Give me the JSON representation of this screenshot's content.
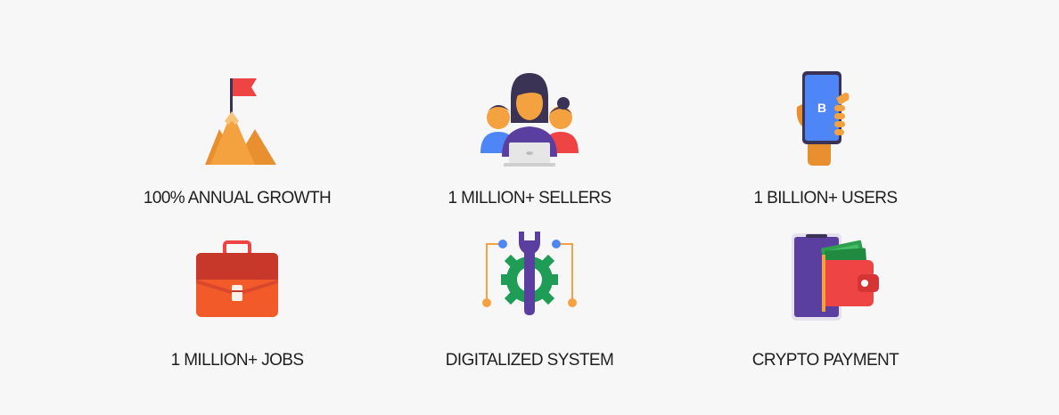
{
  "features": [
    {
      "label": "100% ANNUAL GROWTH",
      "icon": "mountain-flag-icon"
    },
    {
      "label": "1 MILLION+ SELLERS",
      "icon": "sellers-group-icon"
    },
    {
      "label": "1 BILLION+ USERS",
      "icon": "phone-in-hand-icon",
      "phone_letter": "B"
    },
    {
      "label": "1 MILLION+ JOBS",
      "icon": "briefcase-icon"
    },
    {
      "label": "DIGITALIZED SYSTEM",
      "icon": "wrench-gear-icon"
    },
    {
      "label": "CRYPTO PAYMENT",
      "icon": "phone-wallet-icon"
    }
  ],
  "colors": {
    "background": "#f8f7f8",
    "text": "#1f1f1f",
    "orange": "#f4a13f",
    "red": "#ef4444",
    "purple": "#5b3fa0",
    "green": "#16a34a",
    "blue": "#4f86f7"
  }
}
